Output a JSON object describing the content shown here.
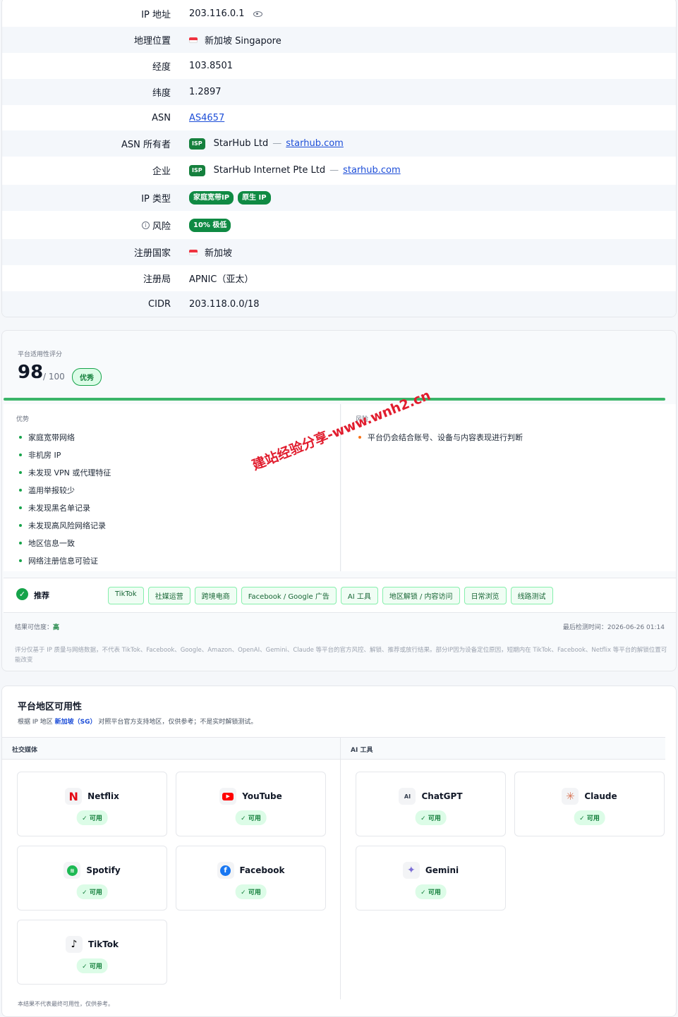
{
  "info": {
    "rows": [
      {
        "key": "IP 地址",
        "value": "203.116.0.1"
      },
      {
        "key": "地理位置",
        "value": "新加坡 Singapore"
      },
      {
        "key": "经度",
        "value": "103.8501"
      },
      {
        "key": "纬度",
        "value": "1.2897"
      },
      {
        "key": "ASN",
        "value": "AS4657"
      },
      {
        "key": "ASN 所有者",
        "badge": "ISP",
        "value": "StarHub Ltd",
        "sep": "—",
        "link": "starhub.com"
      },
      {
        "key": "企业",
        "badge": "ISP",
        "value": "StarHub Internet Pte Ltd",
        "sep": "—",
        "link": "starhub.com"
      },
      {
        "key": "IP 类型",
        "pills": [
          "家庭宽带IP",
          "原生 IP"
        ]
      },
      {
        "key": "风险",
        "pills": [
          "10% 极低"
        ]
      },
      {
        "key": "注册国家",
        "value": "新加坡"
      },
      {
        "key": "注册局",
        "value": "APNIC（亚太）"
      },
      {
        "key": "CIDR",
        "value": "203.118.0.0/18"
      }
    ]
  },
  "score": {
    "label": "平台适用性评分",
    "value": "98",
    "out_of": "/ 100",
    "grade": "优秀",
    "progress": 0.98,
    "pros_title": "优势",
    "pros": [
      "家庭宽带网络",
      "非机房 IP",
      "未发现 VPN 或代理特征",
      "滥用举报较少",
      "未发现黑名单记录",
      "未发现高风险网络记录",
      "地区信息一致",
      "网络注册信息可验证"
    ],
    "risks_title": "风险",
    "risks": [
      "平台仍会结合账号、设备与内容表现进行判断"
    ],
    "recommend_title": "推荐",
    "tags": [
      "TikTok",
      "社媒运营",
      "跨境电商",
      "Facebook / Google 广告",
      "AI 工具",
      "地区解锁 / 内容访问",
      "日常浏览",
      "线路测试"
    ],
    "confidence_label": "结果可信度：",
    "confidence_value": "高",
    "last_checked": "最后检测时间：2026-06-26 01:14",
    "disclaimer": "评分仅基于 IP 质量与网络数据，不代表 TikTok、Facebook、Google、Amazon、OpenAI、Gemini、Claude 等平台的官方风控、解锁、推荐或放行结果。部分IP因为设备定位原因，短期内在 TikTok、Facebook、Netflix 等平台的解锁位置可能改变",
    "watermark": "建站经验分享-www.wnh2.cn"
  },
  "availability": {
    "title": "平台地区可用性",
    "subtitle_pre": "根据 IP 地区 ",
    "subtitle_region": "新加坡（SG）",
    "subtitle_post": " 对照平台官方支持地区，仅供参考；不是实时解锁测试。",
    "col_social": "社交媒体",
    "col_ai": "AI 工具",
    "social": [
      {
        "name": "Netflix",
        "status": "✓ 可用",
        "icon": "netflix-icon"
      },
      {
        "name": "YouTube",
        "status": "✓ 可用",
        "icon": "youtube-icon"
      },
      {
        "name": "Spotify",
        "status": "✓ 可用",
        "icon": "spotify-icon"
      },
      {
        "name": "Facebook",
        "status": "✓ 可用",
        "icon": "facebook-icon"
      },
      {
        "name": "TikTok",
        "status": "✓ 可用",
        "icon": "tiktok-icon"
      }
    ],
    "ai": [
      {
        "name": "ChatGPT",
        "status": "✓ 可用",
        "icon": "chatgpt-icon",
        "glyph": "AI"
      },
      {
        "name": "Claude",
        "status": "✓ 可用",
        "icon": "claude-icon"
      },
      {
        "name": "Gemini",
        "status": "✓ 可用",
        "icon": "gemini-icon"
      }
    ],
    "footnote": "本结果不代表最终可用性，仅供参考。"
  },
  "colors": {
    "accent": "#16a34a",
    "link": "#1d4ed8",
    "watermark": "#e11d2e"
  }
}
